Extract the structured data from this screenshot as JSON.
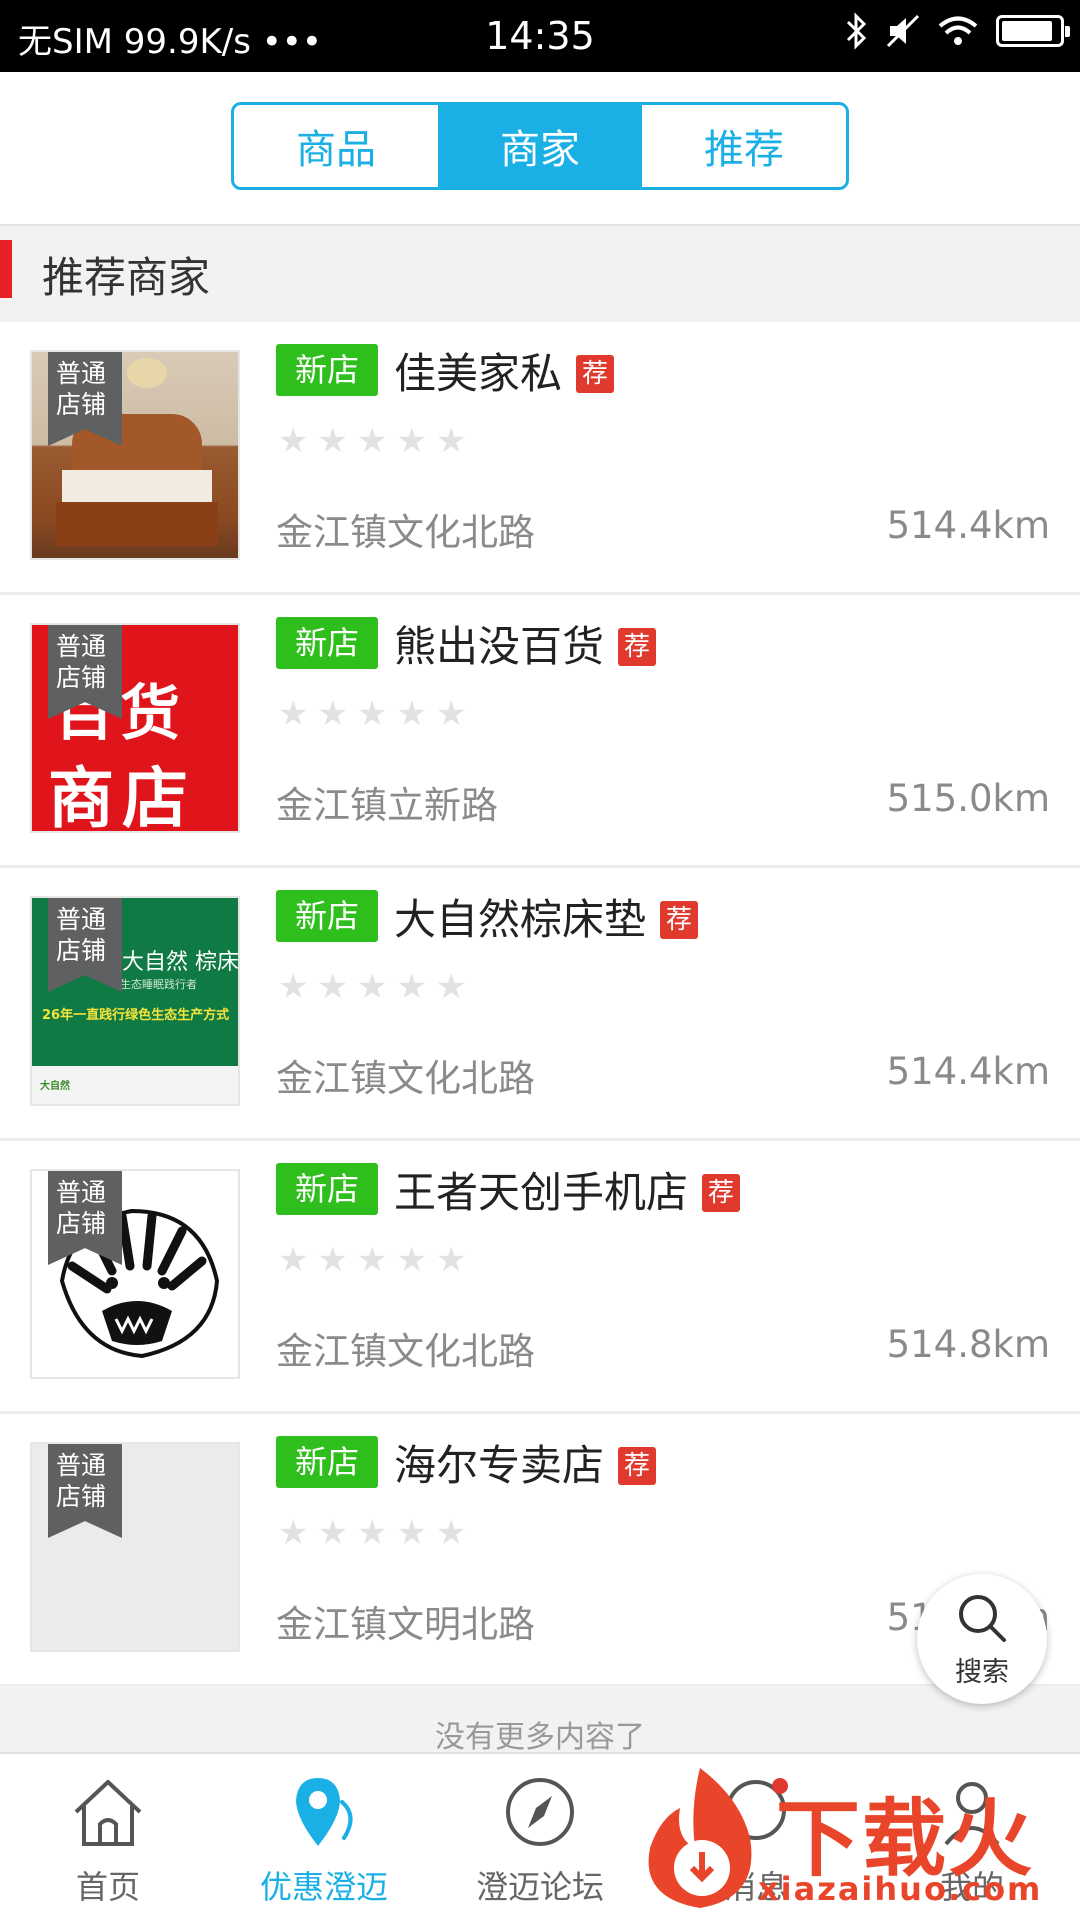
{
  "status_bar": {
    "carrier": "无SIM 99.9K/s •••",
    "time": "14:35",
    "battery_level": 0.9
  },
  "tabs": [
    {
      "label": "商品",
      "active": false
    },
    {
      "label": "商家",
      "active": true
    },
    {
      "label": "推荐",
      "active": false
    }
  ],
  "section": {
    "title": "推荐商家"
  },
  "stores": [
    {
      "ribbon_line1": "普通",
      "ribbon_line2": "店铺",
      "badge_new": "新店",
      "name": "佳美家私",
      "badge_rec": "荐",
      "rating": 0,
      "address": "金江镇文化北路",
      "distance": "514.4km",
      "thumb": "bedroom-furniture"
    },
    {
      "ribbon_line1": "普通",
      "ribbon_line2": "店铺",
      "badge_new": "新店",
      "name": "熊出没百货",
      "badge_rec": "荐",
      "rating": 0,
      "address": "金江镇立新路",
      "distance": "515.0km",
      "thumb": "red-sign",
      "thumb_text1": "百货",
      "thumb_text2": "商店"
    },
    {
      "ribbon_line1": "普通",
      "ribbon_line2": "店铺",
      "badge_new": "新店",
      "name": "大自然棕床垫",
      "badge_rec": "荐",
      "rating": 0,
      "address": "金江镇文化北路",
      "distance": "514.4km",
      "thumb": "green-banner",
      "thumb_title": "大自然 棕床垫",
      "thumb_sub": "生态睡眠践行者",
      "thumb_slogan": "26年一直践行绿色生态生产方式",
      "thumb_footer": "大自然"
    },
    {
      "ribbon_line1": "普通",
      "ribbon_line2": "店铺",
      "badge_new": "新店",
      "name": "王者天创手机店",
      "badge_rec": "荐",
      "rating": 0,
      "address": "金江镇文化北路",
      "distance": "514.8km",
      "thumb": "tiger"
    },
    {
      "ribbon_line1": "普通",
      "ribbon_line2": "店铺",
      "badge_new": "新店",
      "name": "海尔专卖店",
      "badge_rec": "荐",
      "rating": 0,
      "address": "金江镇文明北路",
      "distance": "514.9km",
      "thumb": "placeholder"
    }
  ],
  "floating_search": {
    "label": "搜索",
    "icon": "search-icon"
  },
  "list_end_text": "没有更多内容了",
  "bottom_nav": [
    {
      "label": "首页",
      "icon": "home-icon",
      "active": false
    },
    {
      "label": "优惠澄迈",
      "icon": "location-pin-icon",
      "active": true
    },
    {
      "label": "澄迈论坛",
      "icon": "compass-icon",
      "active": false
    },
    {
      "label": "消息",
      "icon": "message-icon",
      "active": false
    },
    {
      "label": "我的",
      "icon": "user-icon",
      "active": false
    }
  ],
  "watermark": {
    "text": "下载火",
    "url": "xiazaihuo.com"
  },
  "colors": {
    "accent": "#1ab0e6",
    "section_marker": "#e52127",
    "badge_new": "#2ebf1c",
    "badge_rec": "#e03a2e",
    "ribbon": "#5f6062"
  }
}
